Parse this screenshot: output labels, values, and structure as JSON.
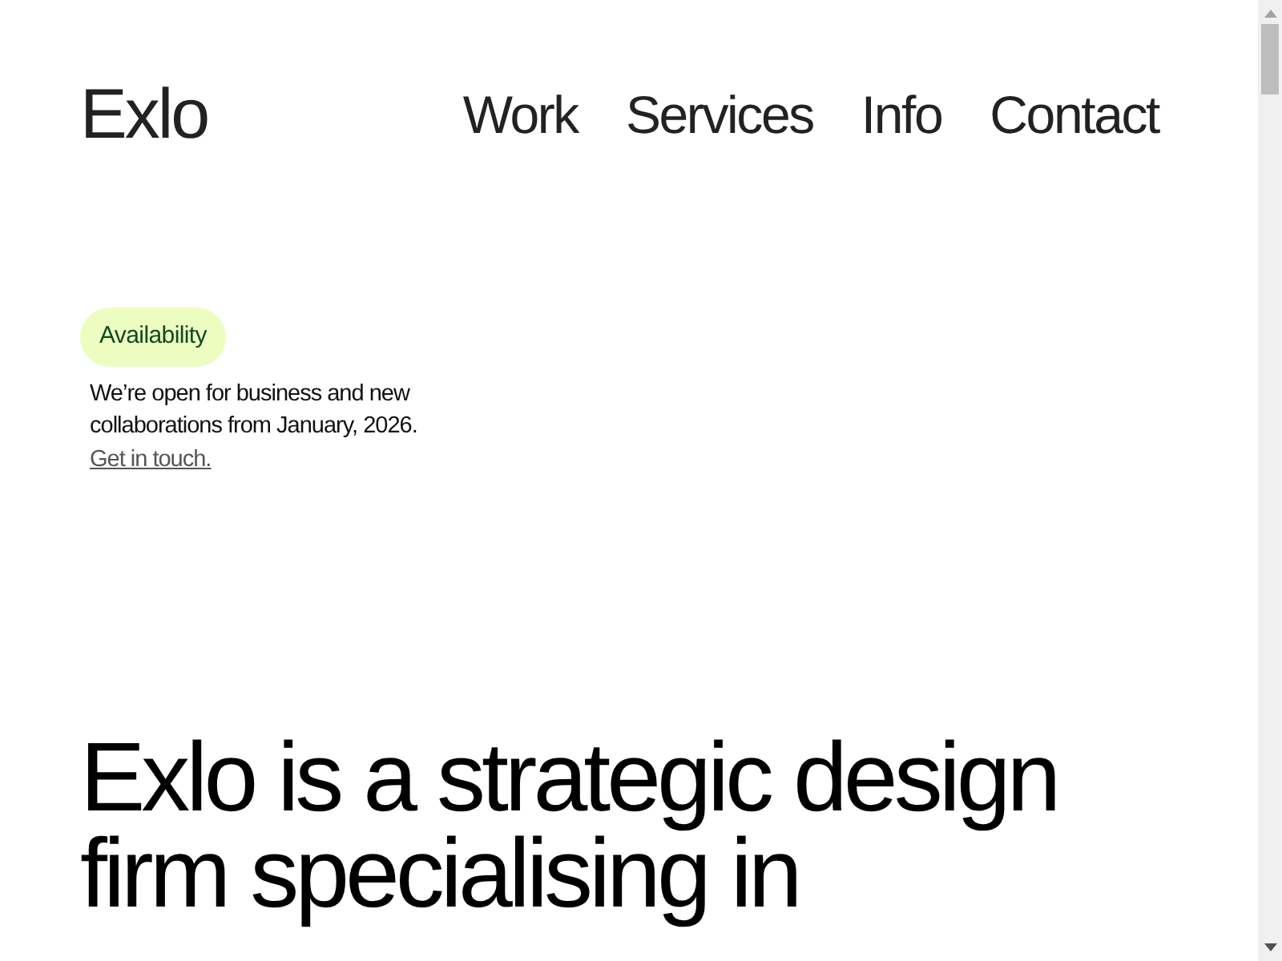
{
  "logo": "Exlo",
  "nav": [
    {
      "label": "Work"
    },
    {
      "label": "Services"
    },
    {
      "label": "Info"
    },
    {
      "label": "Contact"
    }
  ],
  "availability": {
    "badge": "Availability",
    "text": "We’re open for business and new collaborations from January, 2026.",
    "link": "Get in touch."
  },
  "headline": "Exlo is a strategic design firm specialising in"
}
